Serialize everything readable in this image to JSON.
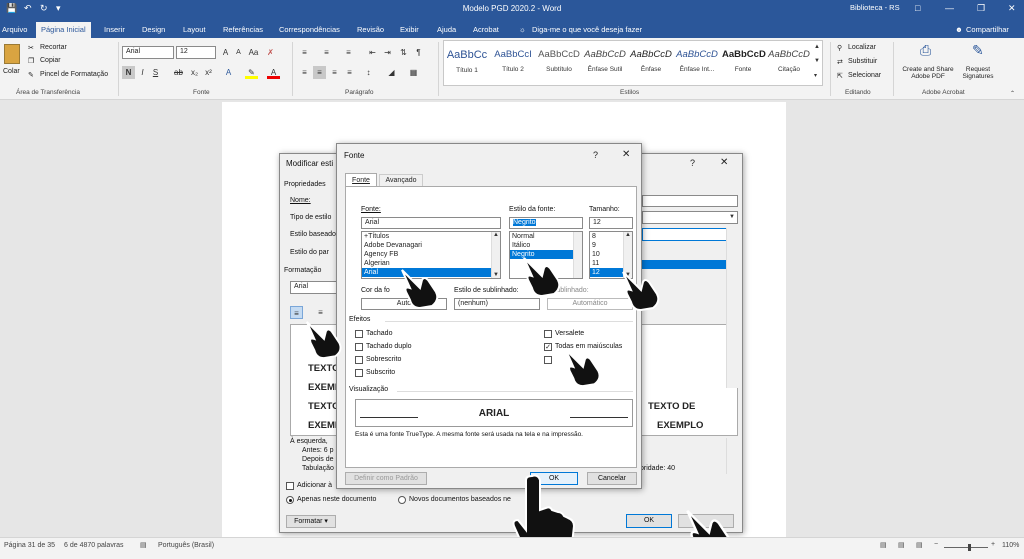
{
  "window": {
    "title": "Modelo PGD 2020.2  -  Word",
    "library": "Biblioteca - RS",
    "share": "Compartilhar"
  },
  "tabs": [
    "Arquivo",
    "Página Inicial",
    "Inserir",
    "Design",
    "Layout",
    "Referências",
    "Correspondências",
    "Revisão",
    "Exibir",
    "Ajuda",
    "Acrobat"
  ],
  "tell_me": "Diga-me o que você deseja fazer",
  "clipboard": {
    "paste": "Colar",
    "cut": "Recortar",
    "copy": "Copiar",
    "painter": "Pincel de Formatação",
    "label": "Área de Transferência"
  },
  "font_group": {
    "font": "Arial",
    "size": "12",
    "label": "Fonte"
  },
  "paragraph_group": {
    "label": "Parágrafo"
  },
  "styles": {
    "label": "Estilos",
    "items": [
      {
        "preview": "AaBbCc",
        "name": "Título 1"
      },
      {
        "preview": "AaBbCcI",
        "name": "Título 2"
      },
      {
        "preview": "AaBbCcD",
        "name": "Subtítulo"
      },
      {
        "preview": "AaBbCcD",
        "name": "Ênfase Sutil"
      },
      {
        "preview": "AaBbCcD",
        "name": "Ênfase"
      },
      {
        "preview": "AaBbCcD",
        "name": "Ênfase Int..."
      },
      {
        "preview": "AaBbCcD",
        "name": "Fonte"
      },
      {
        "preview": "AaBbCcD",
        "name": "Citação"
      }
    ]
  },
  "editing": {
    "find": "Localizar",
    "replace": "Substituir",
    "select": "Selecionar",
    "label": "Editando"
  },
  "acrobat": {
    "create": "Create and Share Adobe PDF",
    "request": "Request Signatures",
    "label": "Adobe Acrobat"
  },
  "modify_dialog": {
    "title": "Modificar esti",
    "properties": "Propriedades",
    "name": "Nome:",
    "style_type": "Tipo de estilo",
    "based_on": "Estilo baseado",
    "next_para": "Estilo do par",
    "formatting": "Formatação",
    "font": "Arial",
    "preview_lines": [
      "TEXTO",
      "EXEMP",
      "TEXTO",
      "EXEMP"
    ],
    "preview_right": [
      "TEXTO DE",
      "EXEMPLO"
    ],
    "desc_lines": [
      "À esquerda,",
      "Antes:  6 p",
      "Depois de",
      "Tabulação"
    ],
    "priority": "oridade: 40",
    "add_gallery": "Adicionar à",
    "only_doc": "Apenas neste documento",
    "new_docs": "Novos documentos baseados ne",
    "format_btn": "Formatar",
    "ok": "OK"
  },
  "font_dialog": {
    "title": "Fonte",
    "tab_font": "Fonte",
    "tab_advanced": "Avançado",
    "font_label": "Fonte:",
    "font_value": "Arial",
    "fonts": [
      "+Títulos",
      "Adobe Devanagari",
      "Agency FB",
      "Algerian",
      "Arial"
    ],
    "style_label": "Estilo da fonte:",
    "style_value": "Negrito",
    "styles": [
      "Normal",
      "Itálico",
      "Negrito"
    ],
    "size_label": "Tamanho:",
    "size_value": "12",
    "sizes": [
      "8",
      "9",
      "10",
      "11",
      "12"
    ],
    "color_label": "Cor da fo",
    "color_value": "Auto",
    "underline_label": "Estilo de sublinhado:",
    "underline_value": "(nenhum)",
    "underline_color_label": "o sublinhado:",
    "underline_color_value": "Automático",
    "effects_label": "Efeitos",
    "effects_left": [
      {
        "label": "Tachado",
        "checked": false
      },
      {
        "label": "Tachado duplo",
        "checked": false
      },
      {
        "label": "Sobrescrito",
        "checked": false
      },
      {
        "label": "Subscrito",
        "checked": false
      }
    ],
    "effects_right": [
      {
        "label": "Versalete",
        "checked": false
      },
      {
        "label": "Todas em maiúsculas",
        "checked": true
      },
      {
        "label": "",
        "checked": false
      }
    ],
    "preview_label": "Visualização",
    "preview_text": "ARIAL",
    "truetype_note": "Esta é uma fonte TrueType. A mesma fonte será usada na tela e na impressão.",
    "default_btn": "Definir como Padrão",
    "ok": "OK",
    "cancel": "Cancelar"
  },
  "status": {
    "page": "Página 31 de 35",
    "words": "6 de 4870 palavras",
    "language": "Português (Brasil)",
    "zoom": "110%"
  }
}
